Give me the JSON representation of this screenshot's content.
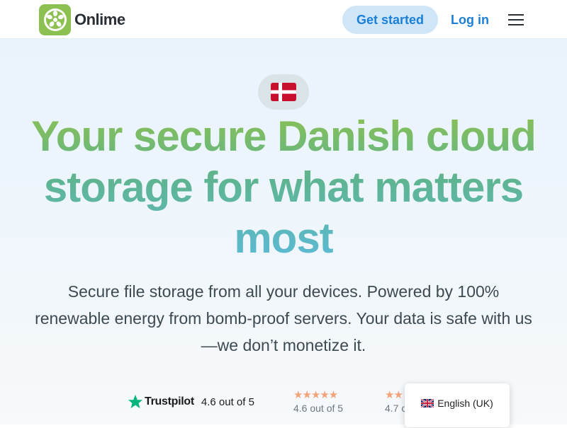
{
  "header": {
    "brand": "Onlime",
    "get_started": "Get started",
    "login": "Log in",
    "menu_icon": "hamburger-menu-icon",
    "logo_color": "#8cc152"
  },
  "hero": {
    "flag_icon": "denmark-flag-icon",
    "headline": "Your secure Danish cloud storage for what matters most",
    "subtext": "Secure file storage from all your devices. Powered by 100% renewable energy from bomb-proof servers. Your data is safe with us—we don’t monetize it."
  },
  "ratings": [
    {
      "provider": "Trustpilot",
      "score_text": "4.6 out of 5",
      "stars": "★★★★★"
    },
    {
      "score_text": "4.6 out of 5",
      "stars": "★★★★★"
    },
    {
      "score_text": "4.7 o",
      "stars": "★★"
    }
  ],
  "language_popup": {
    "label": "English (UK)",
    "flag_icon": "uk-flag-icon"
  }
}
